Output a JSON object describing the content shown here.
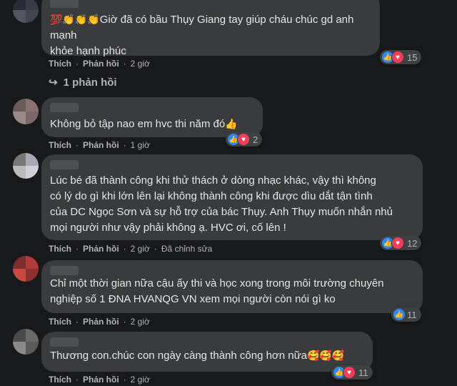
{
  "comments": [
    {
      "text": "Giờ đã có bầu Thụy Giang tay giúp cháu chúc gd anh mạnh\nkhỏe hạnh phúc",
      "leading_emojis": "💯👏👏👏",
      "like_label": "Thích",
      "reply_label": "Phản hồi",
      "time": "2 giờ",
      "reaction_count": "15"
    },
    {
      "text": "Không bỏ tập nao em hvc thi năm đó",
      "trailing_emoji": "👍",
      "like_label": "Thích",
      "reply_label": "Phản hồi",
      "time": "1 giờ",
      "reaction_count": "2"
    },
    {
      "text": "Lúc bé đã thành công khi thử thách ở dòng nhạc khác, vậy thì không\ncó lý do gì khi lớn lên lại không thành công khi được dìu dắt tận tình\ncủa DC Ngọc Sơn và sự hỗ trợ của bác Thụy. Anh Thụy muốn nhắn nhủ\nmọi người như vậy phải không ạ. HVC ơi, cố lên !",
      "like_label": "Thích",
      "reply_label": "Phản hồi",
      "time": "2 giờ",
      "edited": "Đã chỉnh sửa",
      "reaction_count": "12"
    },
    {
      "text": "Chỉ một thời gian nữa cậu ấy thi và học xong trong môi trường chuyên\nnghiệp số 1 ĐNA HVANQG VN xem mọi người còn nói gì ko",
      "like_label": "Thích",
      "reply_label": "Phản hồi",
      "time": "2 giờ",
      "reaction_count": "11"
    },
    {
      "text": "Thương con.chúc con ngày càng thành công hơn nữa",
      "trailing_emoji": "🥰🥰🥰",
      "like_label": "Thích",
      "reply_label": "Phản hồi",
      "time": "2 giờ",
      "reaction_count": "11"
    }
  ],
  "replies_link": "1 phản hồi",
  "colors": {
    "like": "#2d88ff",
    "love": "#f33e58",
    "bubble": "#3a3b3c",
    "background": "#18191a"
  }
}
